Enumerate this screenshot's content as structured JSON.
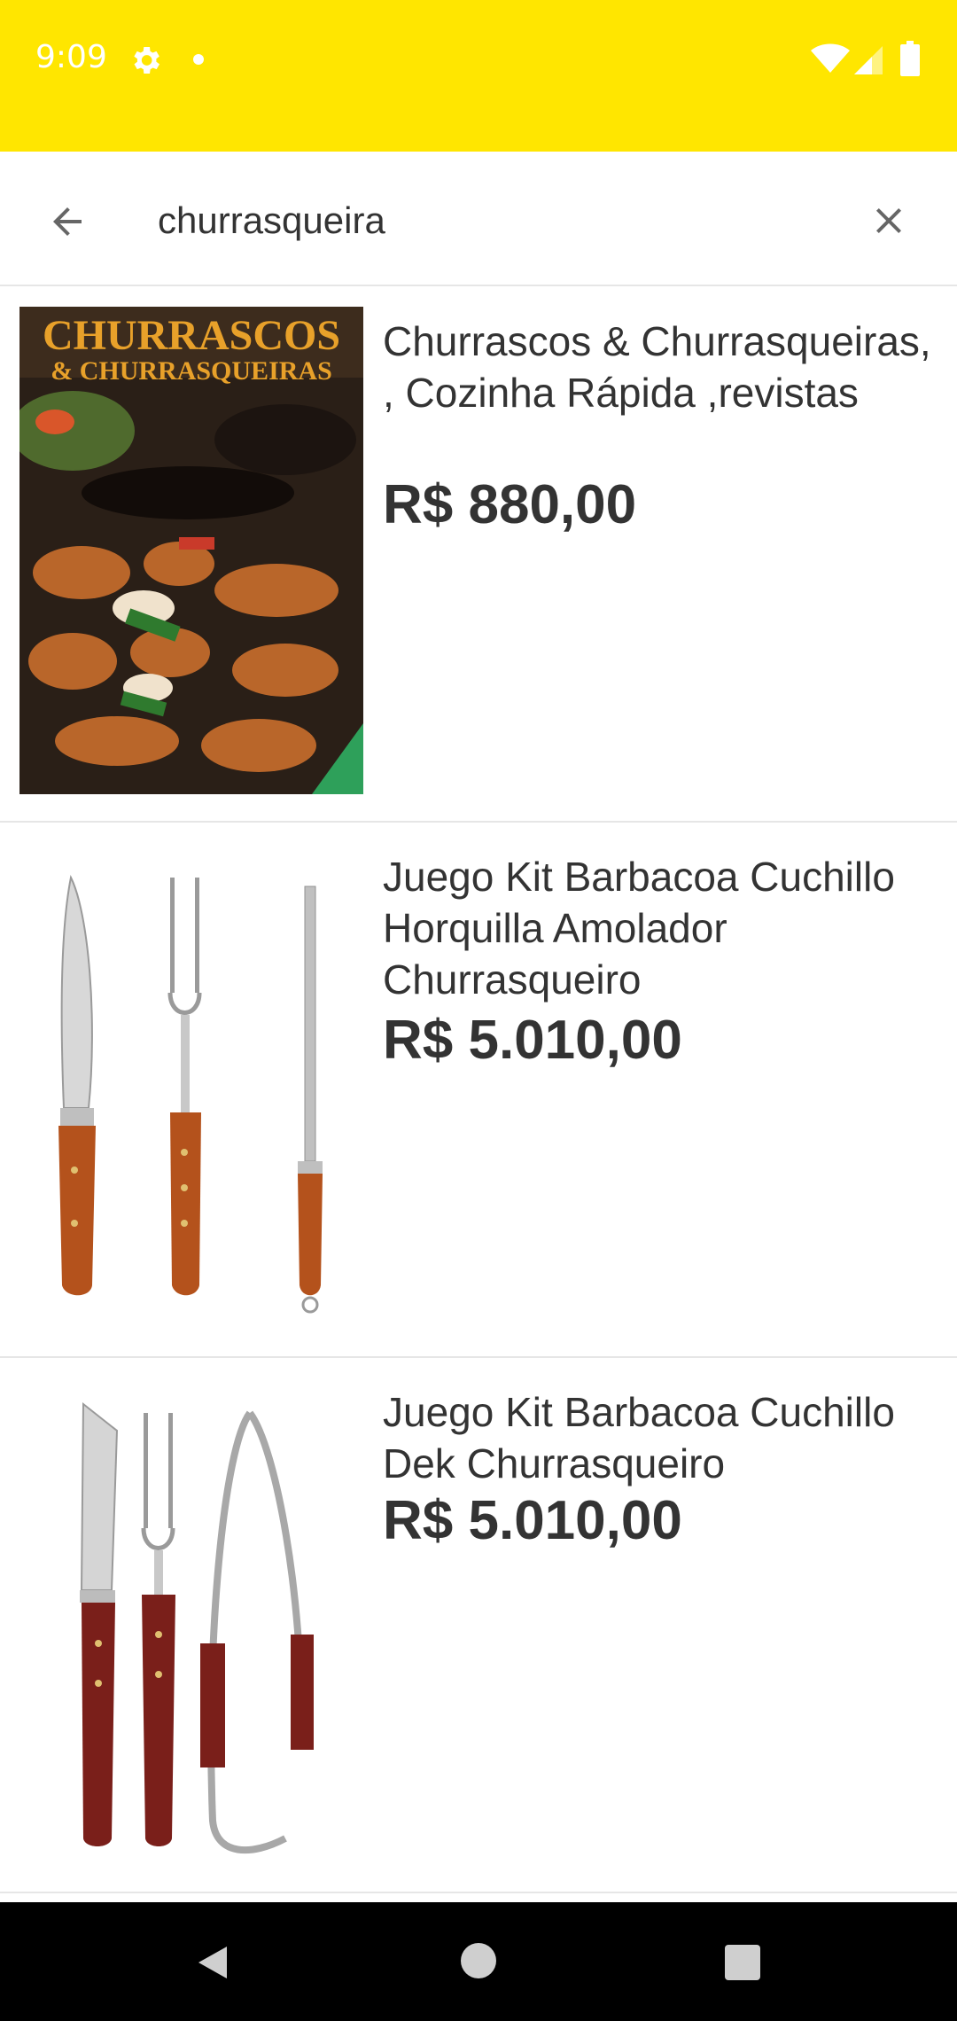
{
  "status_bar": {
    "time": "9:09",
    "background": "#FFE600",
    "icons": [
      "gear-icon",
      "dot-icon",
      "wifi-icon",
      "signal-icon",
      "battery-icon"
    ]
  },
  "search": {
    "query": "churrasqueira",
    "back_icon": "arrow-left-icon",
    "clear_icon": "close-icon"
  },
  "results": [
    {
      "title": "Churrascos & Churrasqueiras, , Cozinha Rápida ,revistas",
      "price": "R$ 880,00",
      "image": "magazine-cover",
      "cover_text_line1": "CHURRASCOS",
      "cover_text_line2": "& CHURRASQUEIRAS"
    },
    {
      "title": "Juego Kit Barbacoa Cuchillo Horquilla Amolador Churrasqueiro",
      "price": "R$ 5.010,00",
      "image": "knife-fork-sharpener"
    },
    {
      "title": "Juego Kit Barbacoa Cuchillo Dek Churrasqueiro",
      "price": "R$ 5.010,00",
      "image": "knife-fork-tongs"
    }
  ],
  "nav_bar": {
    "icons": [
      "nav-back-icon",
      "nav-home-icon",
      "nav-recents-icon"
    ]
  }
}
